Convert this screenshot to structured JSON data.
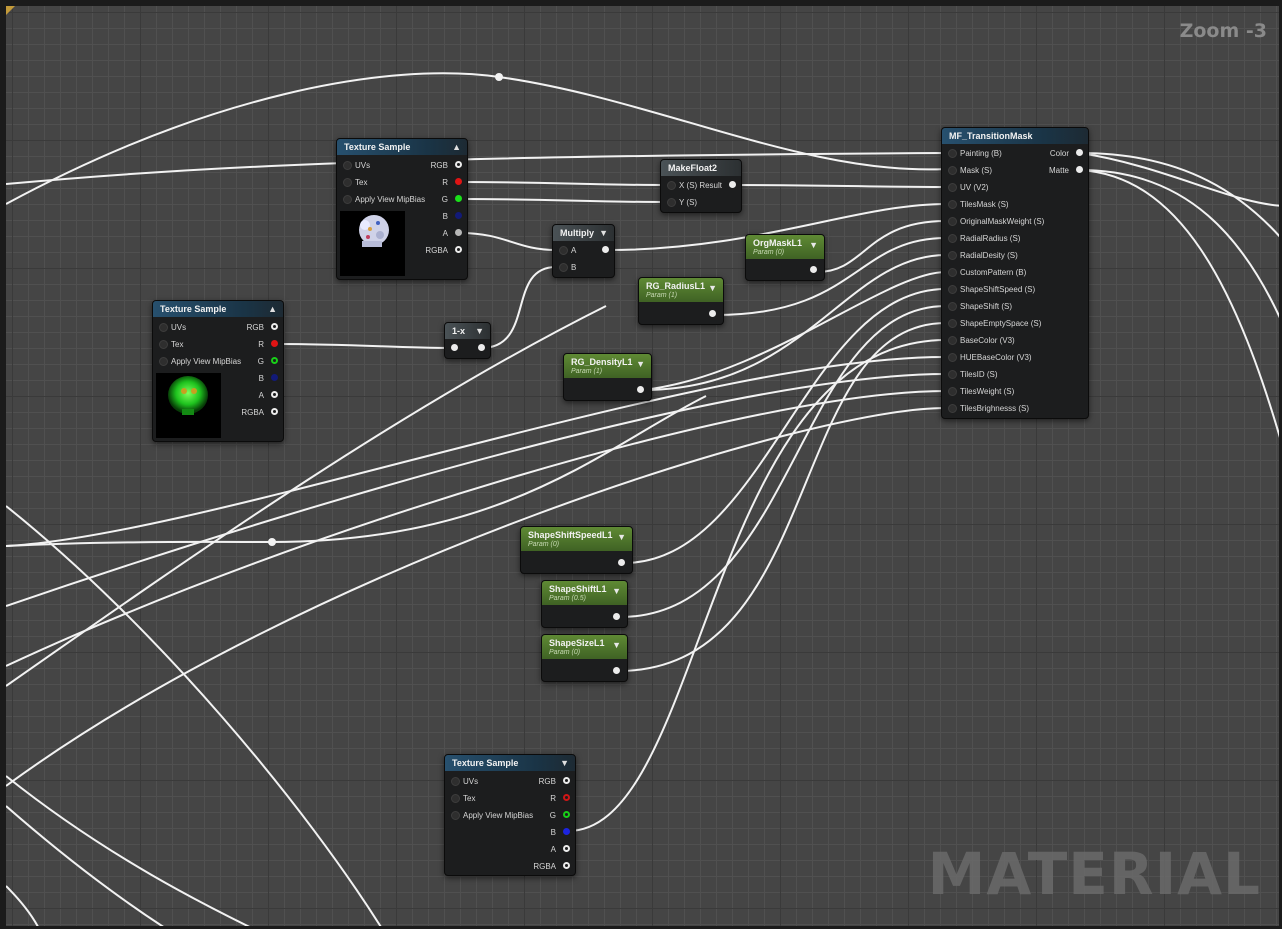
{
  "zoom_label": "Zoom -3",
  "watermark": "MATERIAL",
  "nodes": {
    "tex1": {
      "title": "Texture Sample",
      "inputs": [
        "UVs",
        "Tex",
        "Apply View MipBias"
      ],
      "outputs": [
        "RGB",
        "R",
        "G",
        "B",
        "A",
        "RGBA"
      ]
    },
    "tex2": {
      "title": "Texture Sample",
      "inputs": [
        "UVs",
        "Tex",
        "Apply View MipBias"
      ],
      "outputs": [
        "RGB",
        "R",
        "G",
        "B",
        "A",
        "RGBA"
      ]
    },
    "tex3": {
      "title": "Texture Sample",
      "inputs": [
        "UVs",
        "Tex",
        "Apply View MipBias"
      ],
      "outputs": [
        "RGB",
        "R",
        "G",
        "B",
        "A",
        "RGBA"
      ]
    },
    "makefloat2": {
      "title": "MakeFloat2",
      "inputs": [
        "X (S)",
        "Y (S)"
      ],
      "output": "Result"
    },
    "multiply": {
      "title": "Multiply",
      "inputs": [
        "A",
        "B"
      ]
    },
    "oneminus": {
      "title": "1-x"
    },
    "mf": {
      "title": "MF_TransitionMask",
      "inputs": [
        "Painting (B)",
        "Mask (S)",
        "UV (V2)",
        "TilesMask (S)",
        "OriginalMaskWeight (S)",
        "RadialRadius (S)",
        "RadialDesity (S)",
        "CustomPattern (B)",
        "ShapeShiftSpeed (S)",
        "ShapeShift (S)",
        "ShapeEmptySpace (S)",
        "BaseColor (V3)",
        "HUEBaseColor (V3)",
        "TilesID (S)",
        "TilesWeight (S)",
        "TilesBrighnesss (S)"
      ],
      "outputs": [
        "Color",
        "Matte"
      ]
    }
  },
  "params": {
    "orgmask": {
      "title": "OrgMaskL1",
      "sub": "Param (0)"
    },
    "radius": {
      "title": "RG_RadiusL1",
      "sub": "Param (1)"
    },
    "density": {
      "title": "RG_DensityL1",
      "sub": "Param (1)"
    },
    "speed": {
      "title": "ShapeShiftSpeedL1",
      "sub": "Param (0)"
    },
    "shift": {
      "title": "ShapeShiftL1",
      "sub": "Param (0.5)"
    },
    "size": {
      "title": "ShapeSizeL1",
      "sub": "Param (0)"
    }
  },
  "icons": {
    "collapse": "triangle-up-icon",
    "dropdown": "triangle-down-icon"
  },
  "colors": {
    "graph_bg": "#454545",
    "blue_header": "#27506e",
    "param_header": "#5f8a34",
    "wire": "#f2f2f2"
  }
}
